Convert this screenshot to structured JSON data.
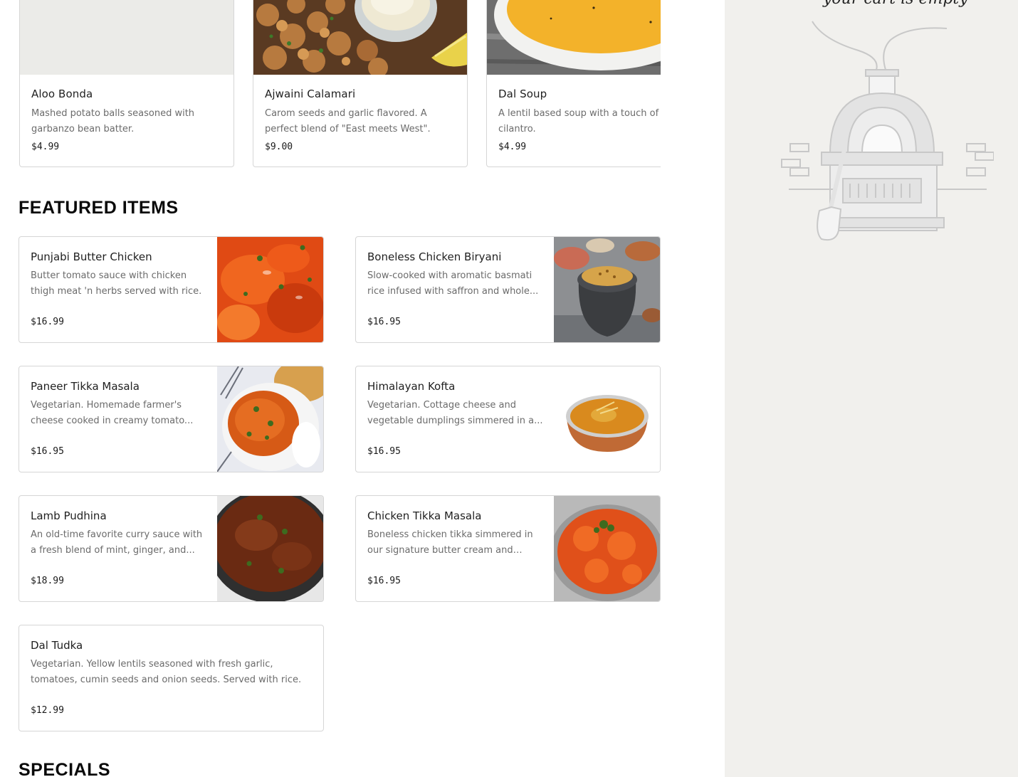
{
  "carousel": [
    {
      "name": "Aloo Bonda",
      "desc": "Mashed potato balls seasoned with garbanzo bean batter.",
      "price": "$4.99",
      "image": "placeholder"
    },
    {
      "name": "Ajwaini Calamari",
      "desc": "Carom seeds and garlic flavored. A perfect blend of \"East meets West\".",
      "price": "$9.00",
      "image": "fried-calamari-photo"
    },
    {
      "name": "Dal Soup",
      "desc": "A lentil based soup with a touch of cilantro.",
      "price": "$4.99",
      "image": "lentil-soup-photo"
    }
  ],
  "featured": {
    "title": "FEATURED ITEMS",
    "items": [
      {
        "name": "Punjabi Butter Chicken",
        "desc": "Butter tomato sauce with chicken thigh meat 'n herbs served with rice.",
        "price": "$16.99",
        "image": "butter-chicken-photo"
      },
      {
        "name": "Boneless Chicken Biryani",
        "desc": "Slow-cooked with aromatic basmati rice infused with saffron and whole...",
        "price": "$16.95",
        "image": "biryani-photo"
      },
      {
        "name": "Paneer Tikka Masala",
        "desc": "Vegetarian. Homemade farmer's cheese cooked in creamy tomato...",
        "price": "$16.95",
        "image": "paneer-tikka-photo"
      },
      {
        "name": "Himalayan Kofta",
        "desc": "Vegetarian. Cottage cheese and vegetable dumplings simmered in a...",
        "price": "$16.95",
        "image": "kofta-photo"
      },
      {
        "name": "Lamb Pudhina",
        "desc": "An old-time favorite curry sauce with a fresh blend of mint, ginger, and...",
        "price": "$18.99",
        "image": "lamb-curry-photo"
      },
      {
        "name": "Chicken Tikka Masala",
        "desc": "Boneless chicken tikka simmered in our signature butter cream and toma...",
        "price": "$16.95",
        "image": "chicken-tikka-photo"
      },
      {
        "name": "Dal Tudka",
        "desc": "Vegetarian. Yellow lentils seasoned with fresh garlic, tomatoes, cumin seeds and onion seeds. Served with rice.",
        "price": "$12.99",
        "image": ""
      }
    ]
  },
  "specials": {
    "title": "SPECIALS"
  },
  "cart": {
    "title": "your cart is empty",
    "illustration": "pizza-oven-icon"
  },
  "colors": {
    "cart_bg": "#f1f0ed",
    "border": "#d6d6d6",
    "muted_text": "#6b6b6b"
  }
}
